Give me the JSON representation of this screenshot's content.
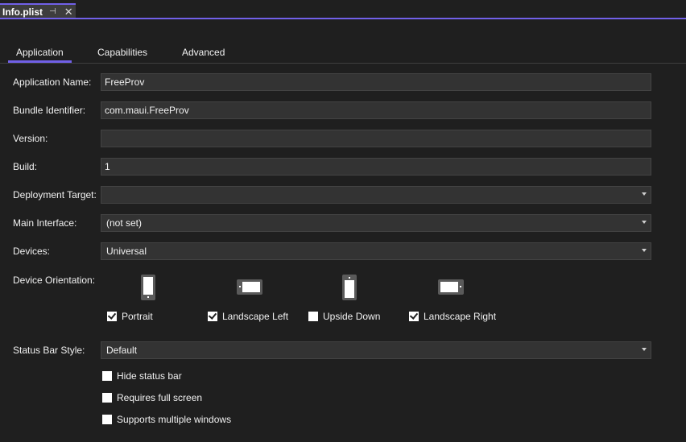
{
  "document_tab": {
    "title": "Info.plist",
    "pin_icon": "pin-icon",
    "close_icon": "close-icon"
  },
  "accent_color": "#7160e8",
  "tabs": [
    {
      "label": "Application",
      "active": true
    },
    {
      "label": "Capabilities",
      "active": false
    },
    {
      "label": "Advanced",
      "active": false
    }
  ],
  "form": {
    "application_name": {
      "label": "Application Name:",
      "value": "FreeProv"
    },
    "bundle_identifier": {
      "label": "Bundle Identifier:",
      "value": "com.maui.FreeProv"
    },
    "version": {
      "label": "Version:",
      "value": ""
    },
    "build": {
      "label": "Build:",
      "value": "1"
    },
    "deployment_target": {
      "label": "Deployment Target:",
      "value": ""
    },
    "main_interface": {
      "label": "Main Interface:",
      "value": "(not set)"
    },
    "devices": {
      "label": "Devices:",
      "value": "Universal"
    },
    "device_orientation": {
      "label": "Device Orientation:",
      "options": [
        {
          "label": "Portrait",
          "checked": true,
          "icon": "portrait-phone-icon"
        },
        {
          "label": "Landscape Left",
          "checked": true,
          "icon": "landscape-left-phone-icon"
        },
        {
          "label": "Upside Down",
          "checked": false,
          "icon": "upside-down-phone-icon"
        },
        {
          "label": "Landscape Right",
          "checked": true,
          "icon": "landscape-right-phone-icon"
        }
      ]
    },
    "status_bar_style": {
      "label": "Status Bar Style:",
      "value": "Default"
    },
    "options": [
      {
        "label": "Hide status bar",
        "checked": false
      },
      {
        "label": "Requires full screen",
        "checked": false
      },
      {
        "label": "Supports multiple windows",
        "checked": false
      }
    ]
  }
}
